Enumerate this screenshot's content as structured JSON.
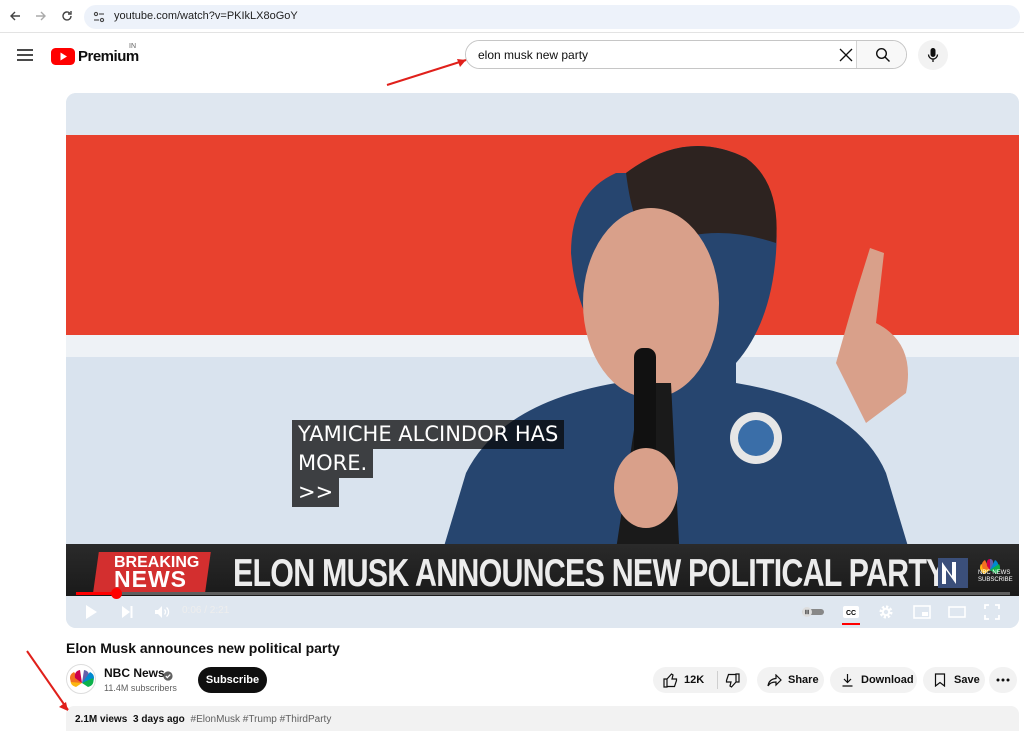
{
  "browser": {
    "url": "youtube.com/watch?v=PKIkLX8oGoY"
  },
  "header": {
    "logo_text": "Premium",
    "region": "IN",
    "search_value": "elon musk new party"
  },
  "player": {
    "caption_lines": [
      "YAMICHE ALCINDOR HAS",
      "MORE.",
      ">>"
    ],
    "breaking_line1": "BREAKING",
    "breaking_line2": "NEWS",
    "headline": "ELON MUSK ANNOUNCES NEW POLITICAL PARTY",
    "badge_text": "NBC NEWS SUBSCRIBE",
    "time": "0:06 / 2:21",
    "progress_fraction": 0.043
  },
  "video": {
    "title": "Elon Musk announces new political party",
    "channel_name": "NBC News",
    "subscribers": "11.4M subscribers",
    "subscribe_label": "Subscribe",
    "likes": "12K",
    "share_label": "Share",
    "download_label": "Download",
    "save_label": "Save",
    "views": "2.1M views",
    "age": "3 days ago",
    "hashtags": "#ElonMusk #Trump #ThirdParty"
  },
  "colors": {
    "brand_red": "#ff0000",
    "flag_red": "#e8412e",
    "breaking_red": "#d32f2f"
  },
  "icons": [
    "back-icon",
    "forward-icon",
    "reload-icon",
    "site-info-icon",
    "menu-icon",
    "youtube-logo-icon",
    "clear-icon",
    "search-icon",
    "mic-icon",
    "play-icon",
    "next-icon",
    "volume-icon",
    "autoplay-toggle-icon",
    "captions-icon",
    "settings-icon",
    "miniplayer-icon",
    "theater-icon",
    "fullscreen-icon",
    "like-icon",
    "dislike-icon",
    "share-icon",
    "download-icon",
    "save-icon",
    "more-icon"
  ]
}
